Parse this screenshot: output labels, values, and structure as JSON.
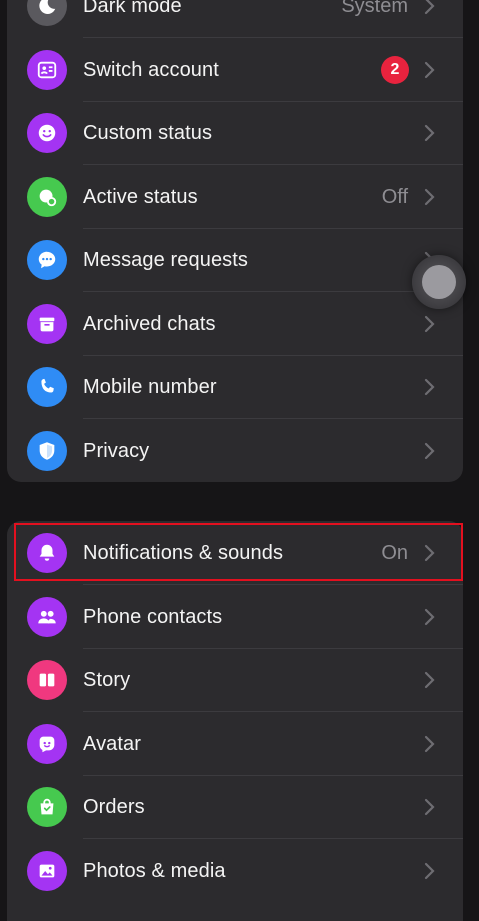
{
  "colors": {
    "purple": "#a434f3",
    "green": "#46c94f",
    "blue": "#2f8cf5",
    "pink": "#f0387f",
    "badge_red": "#e8233e",
    "highlight_red": "#e3101f"
  },
  "group1": [
    {
      "label": "Dark mode",
      "value": "System",
      "icon": "moon-icon"
    },
    {
      "label": "Switch account",
      "badge": "2",
      "icon": "switch-account-icon"
    },
    {
      "label": "Custom status",
      "icon": "smiley-icon"
    },
    {
      "label": "Active status",
      "value": "Off",
      "icon": "active-status-icon"
    },
    {
      "label": "Message requests",
      "icon": "chat-bubble-icon"
    },
    {
      "label": "Archived chats",
      "icon": "archive-box-icon"
    },
    {
      "label": "Mobile number",
      "icon": "phone-icon"
    },
    {
      "label": "Privacy",
      "icon": "shield-icon"
    }
  ],
  "group2": [
    {
      "label": "Notifications & sounds",
      "value": "On",
      "icon": "bell-icon"
    },
    {
      "label": "Phone contacts",
      "icon": "contacts-icon"
    },
    {
      "label": "Story",
      "icon": "story-icon"
    },
    {
      "label": "Avatar",
      "icon": "avatar-icon"
    },
    {
      "label": "Orders",
      "icon": "shopping-bag-icon"
    },
    {
      "label": "Photos & media",
      "icon": "photo-icon"
    }
  ]
}
